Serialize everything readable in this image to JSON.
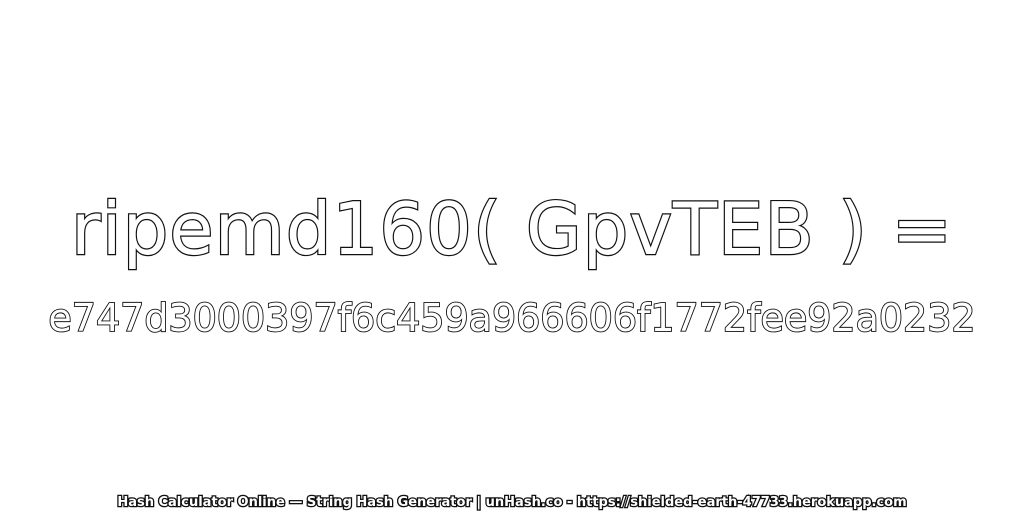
{
  "expression": "ripemd160( GpvTEB ) =",
  "hash_value": "e747d3000397f6c459a966606f1772fee92a0232",
  "footer_text": "Hash Calculator Online — String Hash Generator | unHash.co - https://shielded-earth-47733.herokuapp.com",
  "colors": {
    "background": "#ffffff",
    "text_outline": "#111111",
    "text_fill": "#ffffff"
  }
}
